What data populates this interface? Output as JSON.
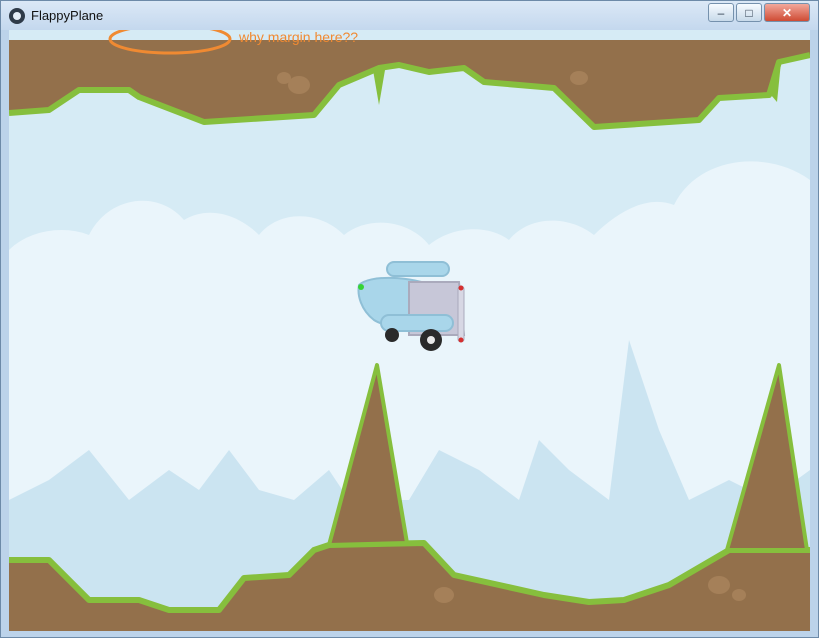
{
  "window": {
    "title": "FlappyPlane"
  },
  "controls": {
    "minimize": "–",
    "maximize": "□",
    "close": "✕"
  },
  "annotation": {
    "text": "why margin here??",
    "color": "#f08a32"
  },
  "colors": {
    "sky": "#d6ebf5",
    "cloud": "#eaf5fb",
    "rock": "#93704b",
    "grass": "#86bf3d",
    "plane": "#a9d6ea",
    "annotation": "#f08a32"
  }
}
